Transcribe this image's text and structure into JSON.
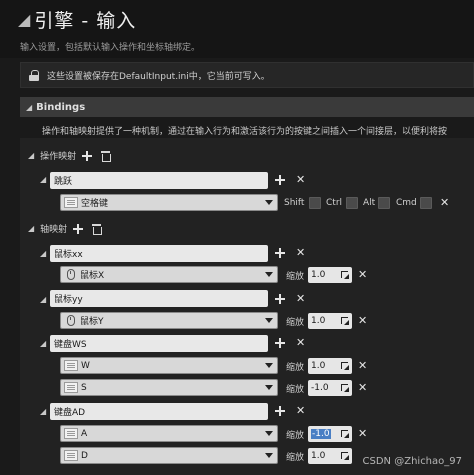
{
  "header": {
    "title": "引擎 - 输入",
    "subtitle": "输入设置，包括默认输入操作和坐标轴绑定。"
  },
  "notice": {
    "text": "这些设置被保存在DefaultInput.ini中，它当前可写入。"
  },
  "section": {
    "title": "Bindings",
    "description": "操作和轴映射提供了一种机制，通过在输入行为和激活该行为的按键之间插入一个间接层，以便利将按"
  },
  "action_mappings": {
    "label": "操作映射",
    "items": [
      {
        "name": "跳跃",
        "key": "空格键",
        "modifiers": [
          "Shift",
          "Ctrl",
          "Alt",
          "Cmd"
        ]
      }
    ]
  },
  "axis_mappings": {
    "label": "轴映射",
    "scale_label": "缩放",
    "items": [
      {
        "name": "鼠标xx",
        "keys": [
          {
            "key": "鼠标X",
            "scale": "1.0",
            "device": "mouse"
          }
        ]
      },
      {
        "name": "鼠标yy",
        "keys": [
          {
            "key": "鼠标Y",
            "scale": "1.0",
            "device": "mouse"
          }
        ]
      },
      {
        "name": "键盘WS",
        "keys": [
          {
            "key": "W",
            "scale": "1.0",
            "device": "keyboard"
          },
          {
            "key": "S",
            "scale": "-1.0",
            "device": "keyboard"
          }
        ]
      },
      {
        "name": "键盘AD",
        "keys": [
          {
            "key": "A",
            "scale": "-1.0",
            "device": "keyboard",
            "selected": true
          },
          {
            "key": "D",
            "scale": "1.0",
            "device": "keyboard"
          }
        ]
      }
    ]
  },
  "watermark": "CSDN @Zhichao_97",
  "colors": {
    "background": "#1a1a1a",
    "panel": "#222222",
    "section_bar": "#3a3a3a",
    "field": "#e8e8e8",
    "selection": "#4a7fc4"
  }
}
